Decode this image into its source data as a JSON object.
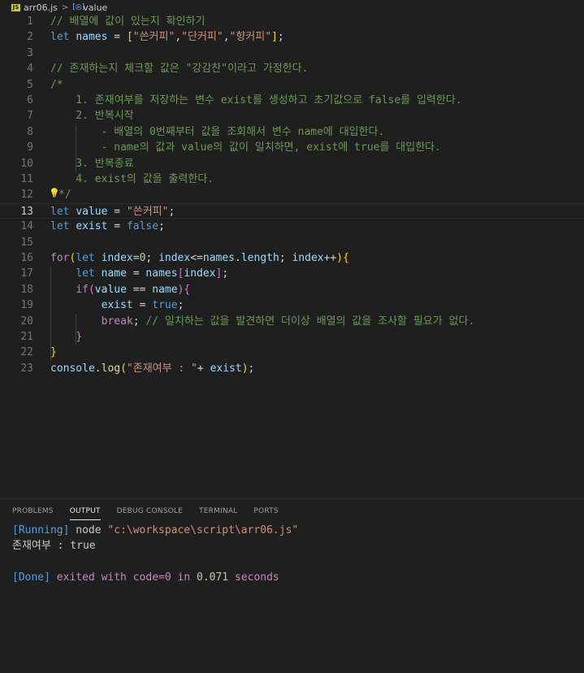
{
  "breadcrumb": {
    "file_icon": "JS",
    "file": "arr06.js",
    "separator": ">",
    "symbol": "value"
  },
  "editor": {
    "current_line": 13,
    "lines": [
      {
        "n": "1",
        "tokens": [
          [
            "com",
            "// 배열에 값이 있는지 확인하기"
          ]
        ]
      },
      {
        "n": "2",
        "tokens": [
          [
            "kw",
            "let"
          ],
          [
            "pun",
            " "
          ],
          [
            "var",
            "names"
          ],
          [
            "pun",
            " = "
          ],
          [
            "b1",
            "["
          ],
          [
            "str",
            "\"쓴커피\""
          ],
          [
            "pun",
            ","
          ],
          [
            "str",
            "\"단커피\""
          ],
          [
            "pun",
            ","
          ],
          [
            "str",
            "\"향커피\""
          ],
          [
            "b1",
            "]"
          ],
          [
            "pun",
            ";"
          ]
        ]
      },
      {
        "n": "3",
        "tokens": []
      },
      {
        "n": "4",
        "tokens": [
          [
            "com",
            "// 존재하는지 체크할 값은 \"강감찬\"이라고 가정한다."
          ]
        ]
      },
      {
        "n": "5",
        "tokens": [
          [
            "com",
            "/*"
          ]
        ]
      },
      {
        "n": "6",
        "tokens": [
          [
            "com",
            "    1. 존재여부를 저장하는 변수 exist를 생성하고 초기값으로 false를 입력한다."
          ]
        ]
      },
      {
        "n": "7",
        "tokens": [
          [
            "com",
            "    2. 반복시작"
          ]
        ]
      },
      {
        "n": "8",
        "tokens": [
          [
            "com",
            "        - 배열의 0번째부터 값을 조회해서 변수 name에 대입한다."
          ]
        ]
      },
      {
        "n": "9",
        "tokens": [
          [
            "com",
            "        - name의 값과 value의 값이 일치하면, exist에 true를 대입한다."
          ]
        ]
      },
      {
        "n": "10",
        "tokens": [
          [
            "com",
            "    3. 반복종료"
          ]
        ]
      },
      {
        "n": "11",
        "tokens": [
          [
            "com",
            "    4. exist의 값을 출력한다."
          ]
        ]
      },
      {
        "n": "12",
        "tokens": [
          [
            "com",
            "*/"
          ]
        ]
      },
      {
        "n": "13",
        "tokens": [
          [
            "kw",
            "let"
          ],
          [
            "pun",
            " "
          ],
          [
            "var",
            "value"
          ],
          [
            "pun",
            " = "
          ],
          [
            "str",
            "\"쓴커피\""
          ],
          [
            "pun",
            ";"
          ]
        ]
      },
      {
        "n": "14",
        "tokens": [
          [
            "kw",
            "let"
          ],
          [
            "pun",
            " "
          ],
          [
            "var",
            "exist"
          ],
          [
            "pun",
            " = "
          ],
          [
            "kw",
            "false"
          ],
          [
            "pun",
            ";"
          ]
        ]
      },
      {
        "n": "15",
        "tokens": []
      },
      {
        "n": "16",
        "tokens": [
          [
            "ctl",
            "for"
          ],
          [
            "b1",
            "("
          ],
          [
            "kw",
            "let"
          ],
          [
            "pun",
            " "
          ],
          [
            "var",
            "index"
          ],
          [
            "pun",
            "="
          ],
          [
            "num",
            "0"
          ],
          [
            "pun",
            "; "
          ],
          [
            "var",
            "index"
          ],
          [
            "pun",
            "<="
          ],
          [
            "var",
            "names"
          ],
          [
            "pun",
            "."
          ],
          [
            "var",
            "length"
          ],
          [
            "pun",
            "; "
          ],
          [
            "var",
            "index"
          ],
          [
            "pun",
            "++"
          ],
          [
            "b1",
            ")"
          ],
          [
            "b1",
            "{"
          ]
        ]
      },
      {
        "n": "17",
        "tokens": [
          [
            "pun",
            "    "
          ],
          [
            "kw",
            "let"
          ],
          [
            "pun",
            " "
          ],
          [
            "var",
            "name"
          ],
          [
            "pun",
            " = "
          ],
          [
            "var",
            "names"
          ],
          [
            "b2",
            "["
          ],
          [
            "var",
            "index"
          ],
          [
            "b2",
            "]"
          ],
          [
            "pun",
            ";"
          ]
        ]
      },
      {
        "n": "18",
        "tokens": [
          [
            "pun",
            "    "
          ],
          [
            "ctl",
            "if"
          ],
          [
            "b2",
            "("
          ],
          [
            "var",
            "value"
          ],
          [
            "pun",
            " == "
          ],
          [
            "var",
            "name"
          ],
          [
            "b2",
            ")"
          ],
          [
            "b2",
            "{"
          ]
        ]
      },
      {
        "n": "19",
        "tokens": [
          [
            "pun",
            "        "
          ],
          [
            "var",
            "exist"
          ],
          [
            "pun",
            " = "
          ],
          [
            "kw",
            "true"
          ],
          [
            "pun",
            ";"
          ]
        ]
      },
      {
        "n": "20",
        "tokens": [
          [
            "pun",
            "        "
          ],
          [
            "ctl",
            "break"
          ],
          [
            "pun",
            "; "
          ],
          [
            "com",
            "// 일치하는 값을 발견하면 더이상 배열의 값을 조사할 필요가 없다."
          ]
        ]
      },
      {
        "n": "21",
        "tokens": [
          [
            "pun",
            "    "
          ],
          [
            "b2",
            "}"
          ]
        ]
      },
      {
        "n": "22",
        "tokens": [
          [
            "b1",
            "}"
          ]
        ]
      },
      {
        "n": "23",
        "tokens": [
          [
            "var",
            "console"
          ],
          [
            "pun",
            "."
          ],
          [
            "fn",
            "log"
          ],
          [
            "b1",
            "("
          ],
          [
            "str",
            "\"존재여부 : \""
          ],
          [
            "pun",
            "+ "
          ],
          [
            "var",
            "exist"
          ],
          [
            "b1",
            ")"
          ],
          [
            "pun",
            ";"
          ]
        ]
      }
    ]
  },
  "panel": {
    "tabs": [
      "PROBLEMS",
      "OUTPUT",
      "DEBUG CONSOLE",
      "TERMINAL",
      "PORTS"
    ],
    "active_tab": "OUTPUT",
    "output": {
      "running_tag": "[Running]",
      "running_cmd": " node ",
      "running_path": "\"c:\\workspace\\script\\arr06.js\"",
      "result": "존재여부 : true",
      "done_tag": "[Done]",
      "done_exit": " exited with ",
      "done_code": "code=0",
      "done_in": " in ",
      "done_time": "0.071",
      "done_seconds": " seconds"
    }
  },
  "colors": {
    "background": "#1f1f1f",
    "comment": "#6a9955",
    "keyword": "#569cd6",
    "control": "#c586c0",
    "variable": "#9cdcfe",
    "string": "#ce9178",
    "number": "#b5cea8",
    "function": "#dcdcaa"
  }
}
